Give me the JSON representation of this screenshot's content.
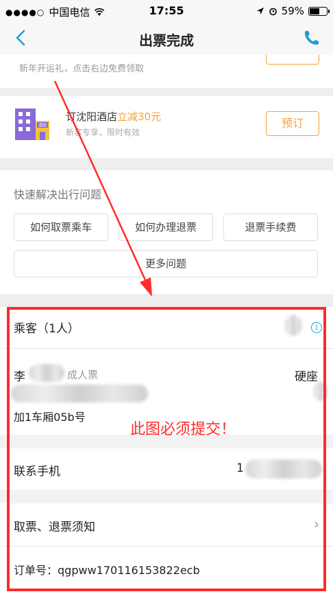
{
  "statusbar": {
    "carrier": "中国电信",
    "time": "17:55",
    "battery": "59%",
    "battery_level": 0.59
  },
  "nav": {
    "title": "出票完成"
  },
  "promo": {
    "text": "新年开运礼，点击右边免费领取"
  },
  "hotel": {
    "title": "订沈阳酒店",
    "highlight": "立减30元",
    "subtitle": "新客专享，限时有效",
    "book_label": "预订",
    "icon_text": "酒店"
  },
  "faq": {
    "heading": "快速解决出行问题",
    "items": [
      "如何取票乘车",
      "如何办理退票",
      "退票手续费",
      "更多问题"
    ]
  },
  "passenger": {
    "header": "乘客（1人）",
    "surname": "李",
    "ticket_type": "成人票",
    "seat_type": "硬座",
    "carriage": "加1车厢05b号"
  },
  "contact": {
    "label": "联系手机",
    "value_prefix": "1"
  },
  "notice": {
    "label": "取票、退票须知"
  },
  "order": {
    "label": "订单号：",
    "value": "qgpww170116153822ecb"
  },
  "annotation": {
    "text": "此图必须提交！"
  },
  "colors": {
    "accent": "#1f9bd6",
    "orange": "#f3a23b",
    "annotation": "#ff2a2a"
  }
}
